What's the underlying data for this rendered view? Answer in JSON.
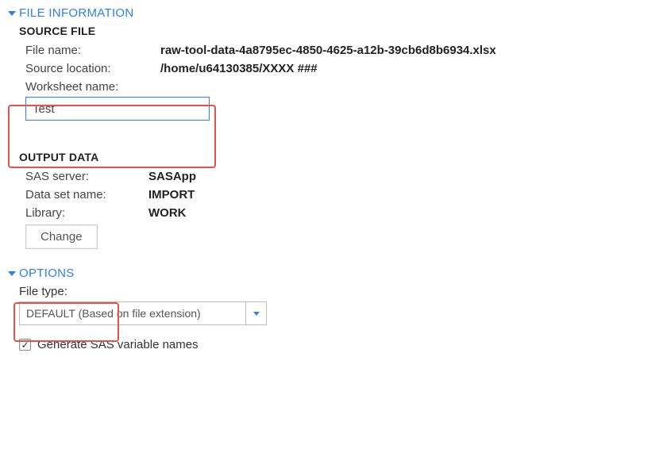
{
  "sections": {
    "file_info": {
      "title": "FILE INFORMATION",
      "source_file": {
        "heading": "SOURCE FILE",
        "file_name_label": "File name:",
        "file_name_value": "raw-tool-data-4a8795ec-4850-4625-a12b-39cb6d8b6934.xlsx",
        "source_loc_label": "Source location:",
        "source_loc_value": "/home/u64130385/XXXX ###",
        "worksheet_label": "Worksheet name:",
        "worksheet_value": "Test"
      },
      "output_data": {
        "heading": "OUTPUT DATA",
        "sas_server_label": "SAS server:",
        "sas_server_value": "SASApp",
        "dataset_label": "Data set name:",
        "dataset_value": "IMPORT",
        "library_label": "Library:",
        "library_value": "WORK",
        "change_label": "Change"
      }
    },
    "options": {
      "title": "OPTIONS",
      "filetype_label": "File type:",
      "filetype_value": "DEFAULT (Based on file extension)",
      "generate_label": "Generate SAS variable names",
      "generate_checked": "✓"
    }
  }
}
